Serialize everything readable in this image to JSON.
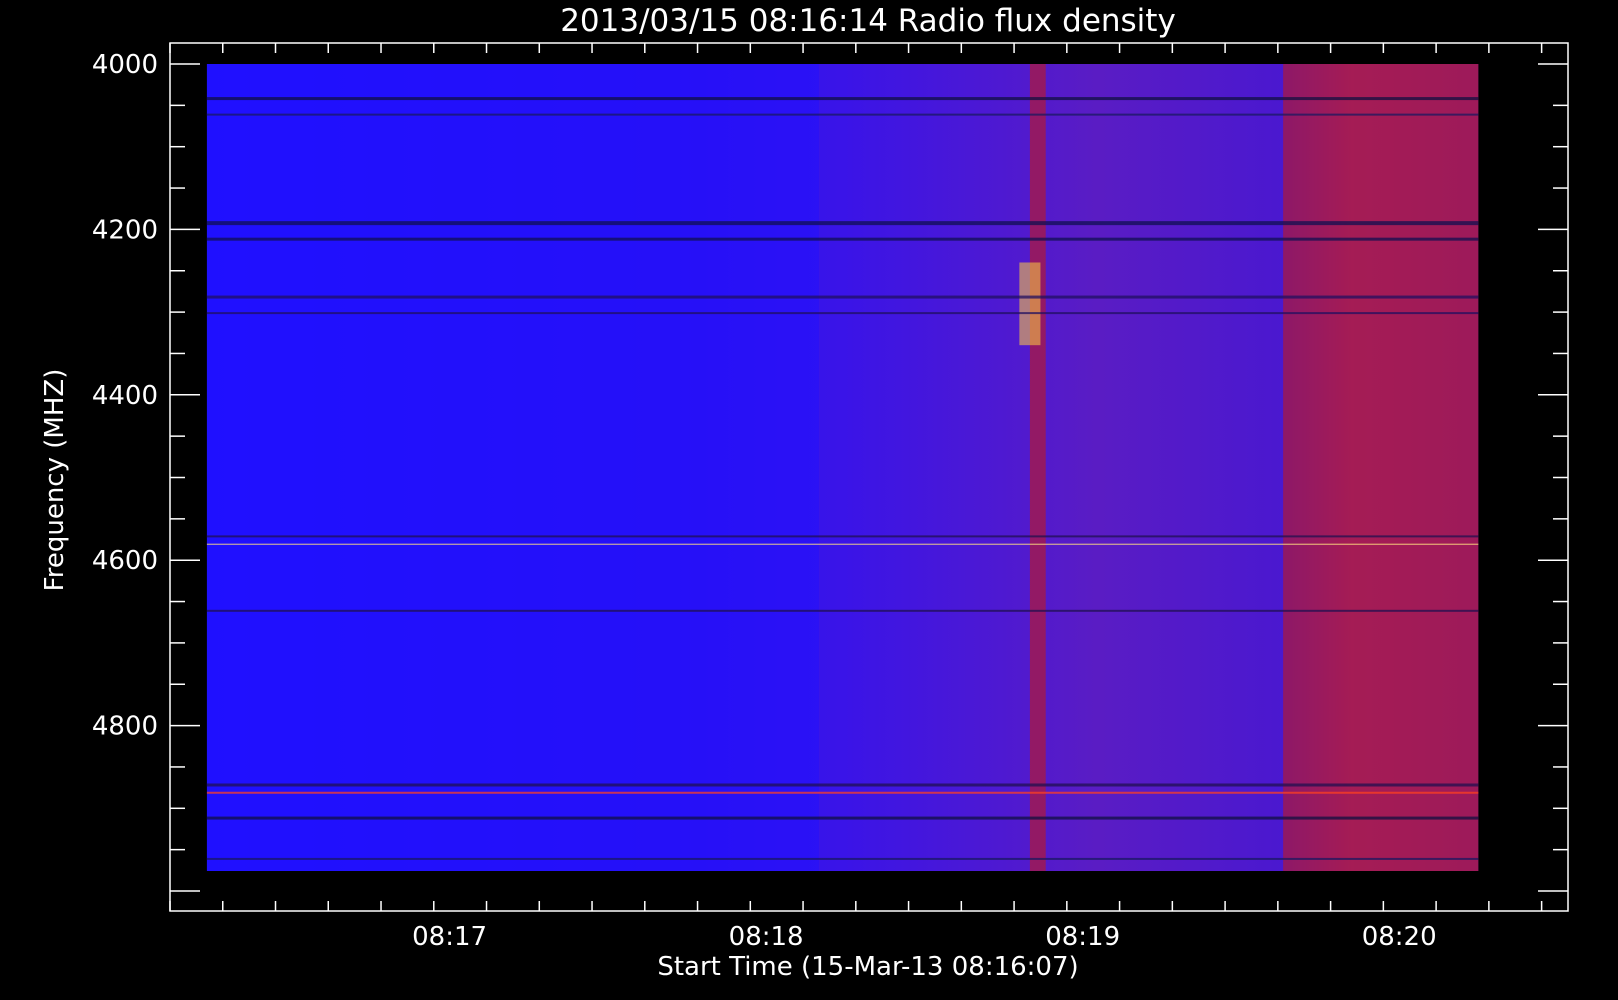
{
  "chart_data": {
    "type": "heatmap",
    "title": "2013/03/15 08:16:14 Radio flux density",
    "xlabel": "Start Time (15-Mar-13 08:16:07)",
    "ylabel": "Frequency (MHZ)",
    "x_ticks": [
      "08:17",
      "08:18",
      "08:19",
      "08:20"
    ],
    "y_ticks": [
      "4000",
      "4200",
      "4400",
      "4600",
      "4800"
    ],
    "xlim": [
      "08:16:07",
      "08:20:32"
    ],
    "ylim": [
      4000,
      5000
    ],
    "data_start": "08:16:14",
    "data_end": "08:20:15",
    "colormap": [
      "#000000",
      "#0000ff",
      "#ff2000",
      "#ffff80"
    ],
    "background_color": "#000000",
    "foreground_color": "#ffffff",
    "grid": false,
    "features": [
      {
        "label": "quiet",
        "start": "08:16:14",
        "end": "08:18:10",
        "freq": [
          4000,
          5000
        ],
        "level": "blue"
      },
      {
        "label": "burst",
        "start": "08:18:50",
        "end": "08:18:53",
        "freq": [
          4000,
          5000
        ],
        "level": "red"
      },
      {
        "label": "enhanced",
        "start": "08:19:38",
        "end": "08:20:15",
        "freq": [
          4000,
          5000
        ],
        "level": "red"
      },
      {
        "label": "spike",
        "start": "08:18:48",
        "end": "08:18:52",
        "freq": [
          4240,
          4340
        ],
        "level": "yellow"
      }
    ]
  }
}
